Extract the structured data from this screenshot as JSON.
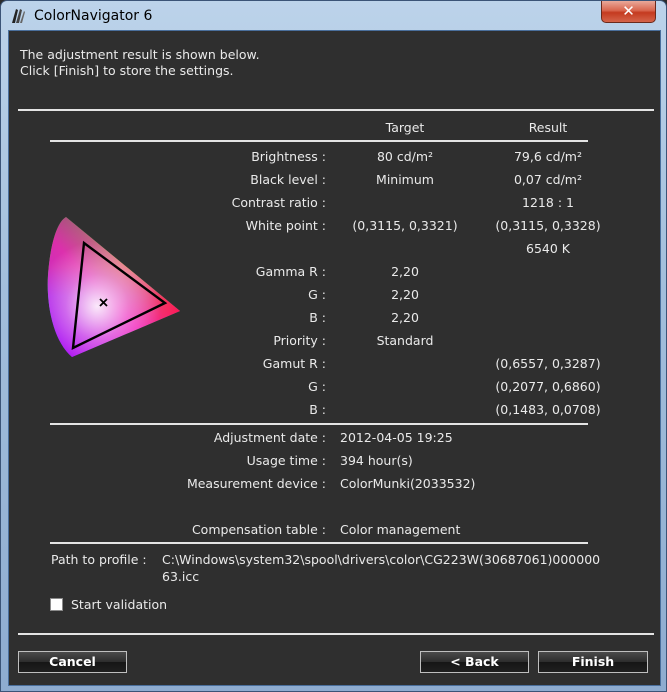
{
  "window": {
    "title": "ColorNavigator 6",
    "close_label": "✕"
  },
  "message": {
    "line1": "The adjustment result is shown below.",
    "line2": "Click [Finish] to store the settings."
  },
  "table": {
    "headers": {
      "target": "Target",
      "result": "Result"
    },
    "rows": [
      {
        "label": "Brightness :",
        "target": "80 cd/m²",
        "result": "79,6 cd/m²"
      },
      {
        "label": "Black level :",
        "target": "Minimum",
        "result": "0,07 cd/m²"
      },
      {
        "label": "Contrast ratio :",
        "target": "",
        "result": "1218 : 1"
      },
      {
        "label": "White point :",
        "target": "(0,3115, 0,3321)",
        "result": "(0,3115, 0,3328)"
      },
      {
        "label": "",
        "target": "",
        "result": "6540 K"
      },
      {
        "label": "Gamma R :",
        "target": "2,20",
        "result": ""
      },
      {
        "label": "G :",
        "target": "2,20",
        "result": ""
      },
      {
        "label": "B :",
        "target": "2,20",
        "result": ""
      },
      {
        "label": "Priority :",
        "target": "Standard",
        "result": ""
      },
      {
        "label": "Gamut R :",
        "target": "",
        "result": "(0,6557, 0,3287)"
      },
      {
        "label": "G :",
        "target": "",
        "result": "(0,2077, 0,6860)"
      },
      {
        "label": "B :",
        "target": "",
        "result": "(0,1483, 0,0708)"
      }
    ]
  },
  "info": [
    {
      "label": "Adjustment date :",
      "value": "2012-04-05 19:25"
    },
    {
      "label": "Usage time :",
      "value": "394 hour(s)"
    },
    {
      "label": "Measurement device :",
      "value": "ColorMunki(2033532)"
    },
    {
      "label": "Compensation table :",
      "value": "Color management"
    }
  ],
  "profile": {
    "label": "Path to profile :",
    "path_line1": "C:\\Windows\\system32\\spool\\drivers\\color\\CG223W(30687061)000000",
    "path_line2": "63.icc"
  },
  "validation": {
    "label": "Start validation",
    "checked": false
  },
  "buttons": {
    "cancel": "Cancel",
    "back": "< Back",
    "finish": "Finish"
  },
  "gamut_diagram": {
    "primaries": {
      "r": [
        0.6557,
        0.3287
      ],
      "g": [
        0.2077,
        0.686
      ],
      "b": [
        0.1483,
        0.0708
      ]
    },
    "white_point": [
      0.3115,
      0.3328
    ]
  }
}
